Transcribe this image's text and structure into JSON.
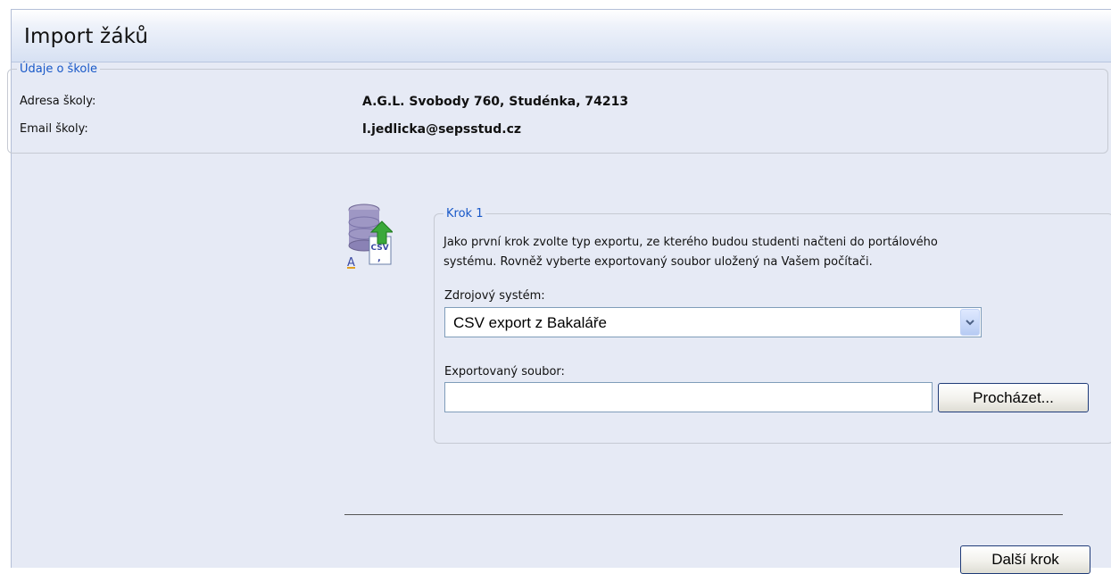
{
  "header": {
    "title": "Import žáků"
  },
  "school": {
    "legend": "Údaje o škole",
    "address_label": "Adresa školy:",
    "address_value": "A.G.L. Svobody 760, Studénka, 74213",
    "email_label": "Email školy:",
    "email_value": "l.jedlicka@sepsstud.cz"
  },
  "icon": {
    "name": "csv-database-import-icon",
    "badge_text": "CSV",
    "letter": "A"
  },
  "step": {
    "legend": "Krok 1",
    "text_line1": "Jako první krok zvolte typ exportu, ze kterého budou studenti načteni do portálového",
    "text_line2": "systému. Rovněž vyberte exportovaný soubor uložený na Vašem počítači.",
    "source_label": "Zdrojový systém:",
    "source_value": "CSV export z Bakaláře",
    "file_label": "Exportovaný soubor:",
    "file_value": "",
    "browse_label": "Procházet..."
  },
  "footer": {
    "next_label": "Další krok"
  },
  "colors": {
    "legend": "#1858c8",
    "panel_bg": "#e6eaf5",
    "header_bg": "#d7e1f3"
  }
}
